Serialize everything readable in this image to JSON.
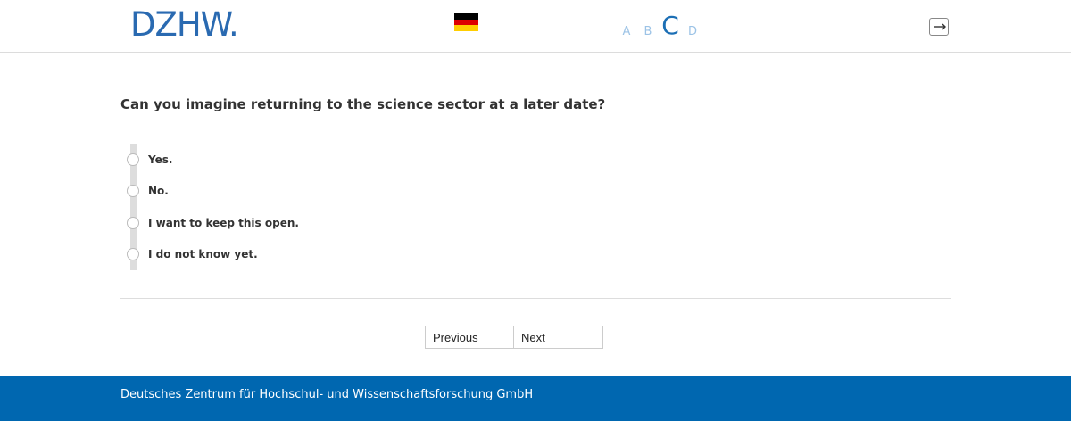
{
  "header": {
    "logo_text": "DZHW.",
    "language_flag": "germany-flag-icon",
    "sections": [
      {
        "label": "A",
        "current": false
      },
      {
        "label": "B",
        "current": false
      },
      {
        "label": "C",
        "current": true
      },
      {
        "label": "D",
        "current": false
      }
    ],
    "exit_icon": "exit-icon"
  },
  "colors": {
    "brand_blue": "#0067b0",
    "logo_blue": "#2a6ab1",
    "section_inactive": "#9cc3e6",
    "section_active": "#1c6fb5",
    "flag": [
      "#000000",
      "#dd0000",
      "#ffce00"
    ]
  },
  "question": {
    "text": "Can you imagine returning to the science sector at a later date?",
    "options": [
      {
        "label": "Yes.",
        "selected": false
      },
      {
        "label": "No.",
        "selected": false
      },
      {
        "label": "I want to keep this open.",
        "selected": false
      },
      {
        "label": "I do not know yet.",
        "selected": false
      }
    ]
  },
  "navigation": {
    "previous_label": "Previous",
    "next_label": "Next"
  },
  "footer": {
    "text": "Deutsches Zentrum für Hochschul- und Wissenschaftsforschung GmbH"
  }
}
